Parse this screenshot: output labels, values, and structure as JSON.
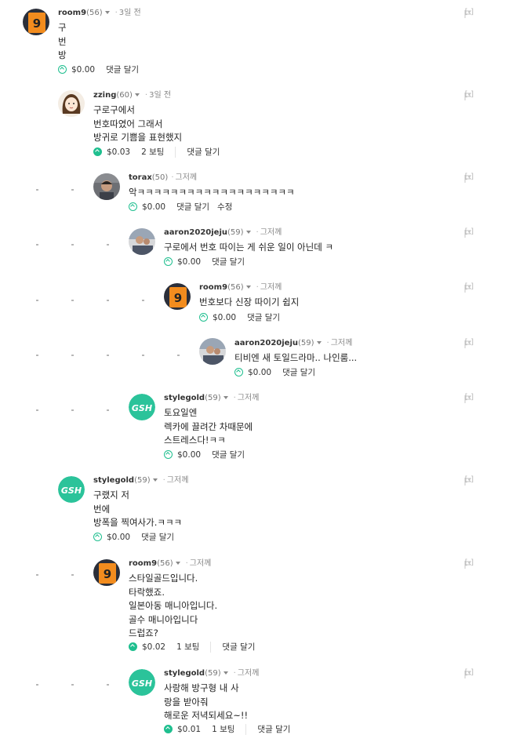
{
  "thread": {
    "comments": [
      {
        "author": "room9",
        "rep": "(56)",
        "time": "3일 전",
        "lines": [
          "구",
          "번",
          "방"
        ],
        "payout": "$0.00",
        "votes": "",
        "reply": "댓글 달기",
        "edit": ""
      },
      {
        "author": "zzing",
        "rep": "(60)",
        "time": "3일 전",
        "lines": [
          "구로구에서",
          "번호따였어 그래서",
          "방귀로 기쁨을 표현했지"
        ],
        "payout": "$0.03",
        "votes": "2 보팅",
        "reply": "댓글 달기",
        "edit": ""
      },
      {
        "author": "torax",
        "rep": "(50)",
        "time": "그저께",
        "lines": [
          "악ㅋㅋㅋㅋㅋㅋㅋㅋㅋㅋㅋㅋㅋㅋㅋㅋㅋㅋㅋ"
        ],
        "payout": "$0.00",
        "votes": "",
        "reply": "댓글 달기",
        "edit": "수정"
      },
      {
        "author": "aaron2020jeju",
        "rep": "(59)",
        "time": "그저께",
        "lines": [
          "구로에서 번호 따이는 게 쉬운 일이 아닌데 ㅋ"
        ],
        "payout": "$0.00",
        "votes": "",
        "reply": "댓글 달기",
        "edit": ""
      },
      {
        "author": "room9",
        "rep": "(56)",
        "time": "그저께",
        "lines": [
          "번호보다 신장 따이기 쉽지"
        ],
        "payout": "$0.00",
        "votes": "",
        "reply": "댓글 달기",
        "edit": ""
      },
      {
        "author": "aaron2020jeju",
        "rep": "(59)",
        "time": "그저께",
        "lines": [
          "티비엔 새 토일드라마.. 나인룸..."
        ],
        "payout": "$0.00",
        "votes": "",
        "reply": "댓글 달기",
        "edit": ""
      },
      {
        "author": "stylegold",
        "rep": "(59)",
        "time": "그저께",
        "lines": [
          "토요일엔",
          "렉카에 끌려간 차때문에",
          "스트레스다!ㅋㅋ"
        ],
        "payout": "$0.00",
        "votes": "",
        "reply": "댓글 달기",
        "edit": ""
      },
      {
        "author": "stylegold",
        "rep": "(59)",
        "time": "그저께",
        "lines": [
          "구랬지 저",
          "번에",
          "방폭을 찍여사가.ㅋㅋㅋ"
        ],
        "payout": "$0.00",
        "votes": "",
        "reply": "댓글 달기",
        "edit": ""
      },
      {
        "author": "room9",
        "rep": "(56)",
        "time": "그저께",
        "lines": [
          "스타일골드입니다.",
          "타락했죠.",
          "일본아동 매니아입니다.",
          "골수 매니아입니다",
          "드럽죠?"
        ],
        "payout": "$0.02",
        "votes": "1 보팅",
        "reply": "댓글 달기",
        "edit": ""
      },
      {
        "author": "stylegold",
        "rep": "(59)",
        "time": "그저께",
        "lines": [
          "사랑해 방구형 내 사",
          "랑을 받아줘",
          "해로운 저녁되세요~!!"
        ],
        "payout": "$0.01",
        "votes": "1 보팅",
        "reply": "댓글 달기",
        "edit": ""
      }
    ],
    "collapse_label": "[-]",
    "logo_nine": "9",
    "logo_gsh": "GSH",
    "colors": {
      "accent": "#1fbf8f",
      "nine_bg": "#f28c1e",
      "gsh_bg": "#2bc39a"
    }
  }
}
